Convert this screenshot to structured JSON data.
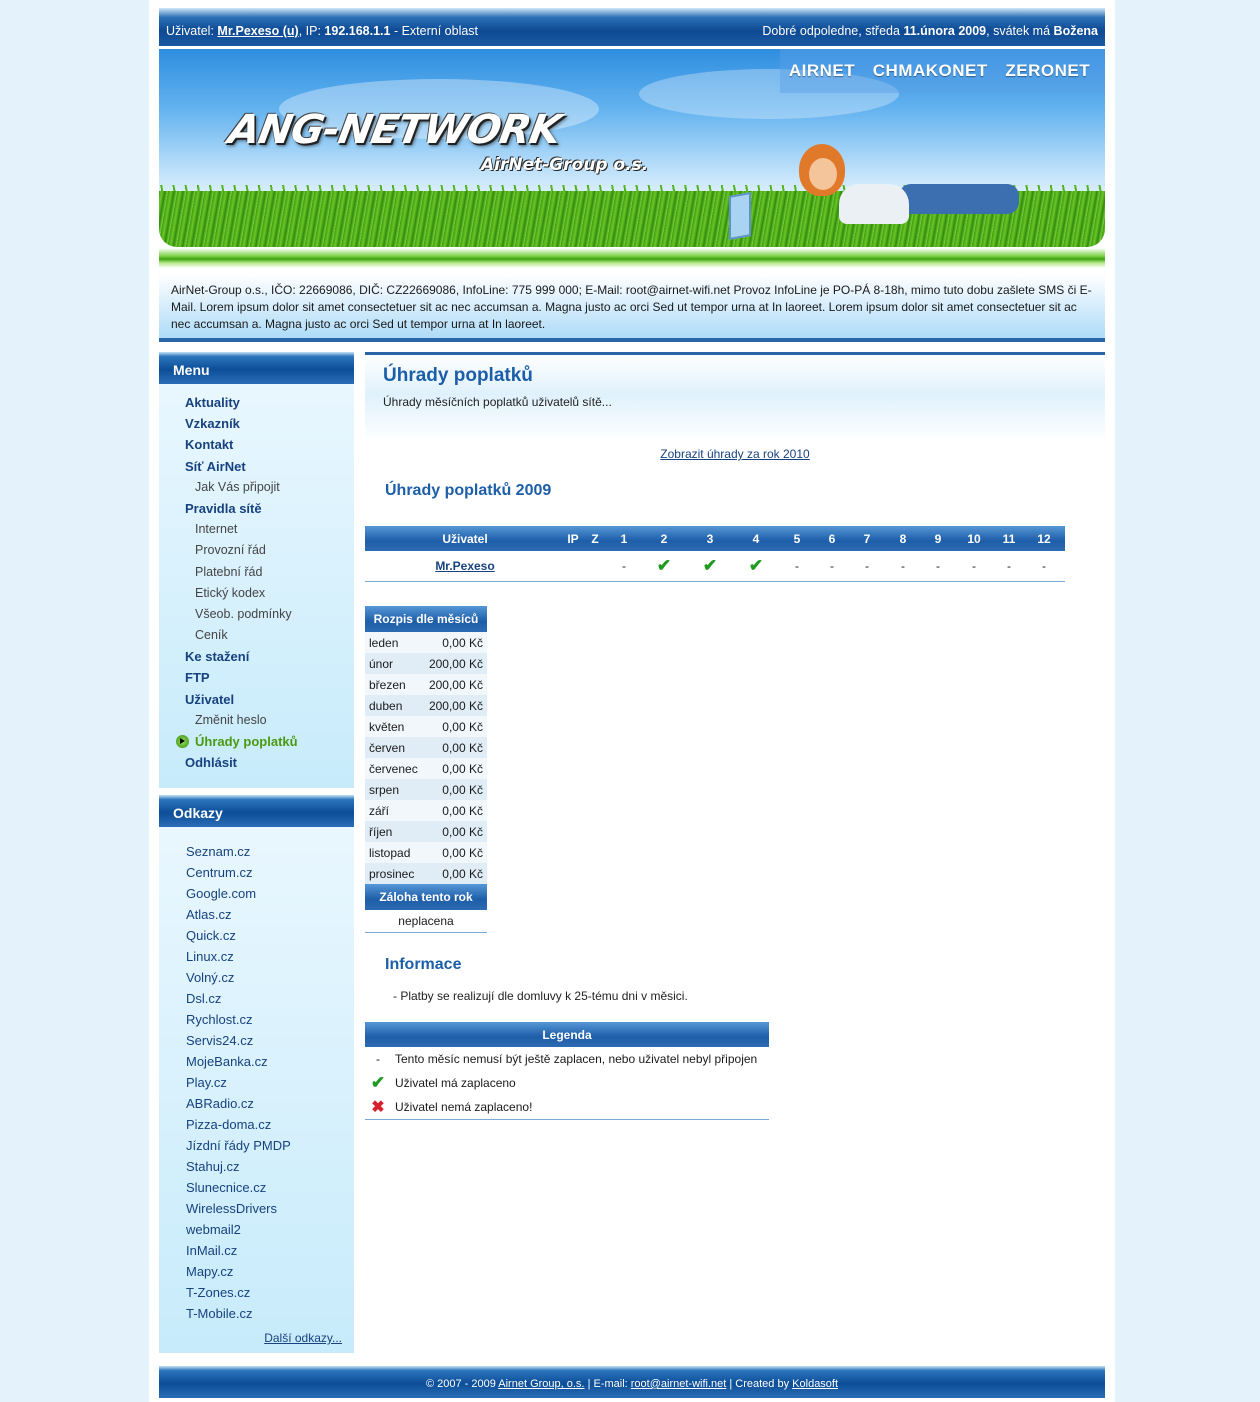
{
  "topbar": {
    "user_label": "Uživatel:",
    "user_name": "Mr.Pexeso (u)",
    "ip_label": ", IP:",
    "ip_value": "192.168.1.1",
    "zone": "- Externí oblast",
    "greeting": "Dobré odpoledne, středa",
    "date": "11.února 2009",
    "nameday_label": ", svátek má",
    "nameday_name": "Božena"
  },
  "header": {
    "nav": [
      "AIRNET",
      "CHMAKONET",
      "ZERONET"
    ],
    "logo_text": "ANG-NETWORK",
    "logo_sub": "AirNet-Group o.s."
  },
  "info_text": "AirNet-Group o.s., IČO: 22669086, DIČ: CZ22669086, InfoLine: 775 999 000; E-Mail: root@airnet-wifi.net Provoz InfoLine je PO-PÁ 8-18h, mimo tuto dobu zašlete SMS či E-Mail. Lorem ipsum dolor sit amet consectetuer sit ac nec accumsan a. Magna justo ac orci Sed ut tempor urna at In laoreet. Lorem ipsum dolor sit amet consectetuer sit ac nec accumsan a. Magna justo ac orci Sed ut tempor urna at In laoreet.",
  "menu": {
    "title": "Menu",
    "items": [
      {
        "label": "Aktuality",
        "level": 1
      },
      {
        "label": "Vzkazník",
        "level": 1
      },
      {
        "label": "Kontakt",
        "level": 1
      },
      {
        "label": "Síť AirNet",
        "level": 1
      },
      {
        "label": "Jak Vás připojit",
        "level": 2
      },
      {
        "label": "Pravidla sítě",
        "level": 1
      },
      {
        "label": "Internet",
        "level": 2
      },
      {
        "label": "Provozní řád",
        "level": 2
      },
      {
        "label": "Platební řád",
        "level": 2
      },
      {
        "label": "Etický kodex",
        "level": 2
      },
      {
        "label": "Všeob. podmínky",
        "level": 2
      },
      {
        "label": "Ceník",
        "level": 2
      },
      {
        "label": "Ke stažení",
        "level": 1
      },
      {
        "label": "FTP",
        "level": 1
      },
      {
        "label": "Uživatel",
        "level": 1
      },
      {
        "label": "Změnit heslo",
        "level": 2
      },
      {
        "label": "Úhrady poplatků",
        "level": 1,
        "active": true
      },
      {
        "label": "Odhlásit",
        "level": 1
      }
    ]
  },
  "links": {
    "title": "Odkazy",
    "items": [
      "Seznam.cz",
      "Centrum.cz",
      "Google.com",
      "Atlas.cz",
      "Quick.cz",
      "Linux.cz",
      "Volný.cz",
      "Dsl.cz",
      "Rychlost.cz",
      "Servis24.cz",
      "MojeBanka.cz",
      "Play.cz",
      "ABRadio.cz",
      "Pizza-doma.cz",
      "Jízdní řády PMDP",
      "Stahuj.cz",
      "Slunecnice.cz",
      "WirelessDrivers",
      "webmail2",
      "InMail.cz",
      "Mapy.cz",
      "T-Zones.cz",
      "T-Mobile.cz"
    ],
    "more": "Další odkazy..."
  },
  "main": {
    "title": "Úhrady poplatků",
    "subtitle": "Úhrady měsíčních poplatků uživatelů sítě...",
    "year_link": "Zobrazit úhrady za rok 2010",
    "section_title": "Úhrady poplatků 2009",
    "pay_table": {
      "headers": [
        "Uživatel",
        "IP",
        "Z",
        "1",
        "2",
        "3",
        "4",
        "5",
        "6",
        "7",
        "8",
        "9",
        "10",
        "11",
        "12"
      ],
      "row": {
        "user": "Mr.Pexeso",
        "ip": "",
        "z": "",
        "months": [
          "-",
          "check",
          "check",
          "check",
          "-",
          "-",
          "-",
          "-",
          "-",
          "-",
          "-",
          "-"
        ]
      }
    },
    "month_breakdown": {
      "title": "Rozpis dle měsíců",
      "rows": [
        {
          "month": "leden",
          "amount": "0,00 Kč"
        },
        {
          "month": "únor",
          "amount": "200,00 Kč"
        },
        {
          "month": "březen",
          "amount": "200,00 Kč"
        },
        {
          "month": "duben",
          "amount": "200,00 Kč"
        },
        {
          "month": "květen",
          "amount": "0,00 Kč"
        },
        {
          "month": "červen",
          "amount": "0,00 Kč"
        },
        {
          "month": "červenec",
          "amount": "0,00 Kč"
        },
        {
          "month": "srpen",
          "amount": "0,00 Kč"
        },
        {
          "month": "září",
          "amount": "0,00 Kč"
        },
        {
          "month": "říjen",
          "amount": "0,00 Kč"
        },
        {
          "month": "listopad",
          "amount": "0,00 Kč"
        },
        {
          "month": "prosinec",
          "amount": "0,00 Kč"
        }
      ],
      "deposit_title": "Záloha tento rok",
      "deposit_value": "neplacena"
    },
    "info_title": "Informace",
    "info_text": "- Platby se realizují dle domluvy k 25-tému dni v měsici.",
    "legend": {
      "title": "Legenda",
      "rows": [
        {
          "symbol": "-",
          "icon": "dash",
          "text": "Tento měsíc nemusí být ještě zaplacen, nebo uživatel nebyl připojen"
        },
        {
          "symbol": "✔",
          "icon": "check-icon",
          "text": "Uživatel má zaplaceno"
        },
        {
          "symbol": "✖",
          "icon": "cross-icon",
          "text": "Uživatel nemá zaplaceno!"
        }
      ]
    }
  },
  "footer": {
    "copyright": "© 2007 - 2009",
    "company_link": "Airnet Group, o.s.",
    "email_label": "| E-mail:",
    "email_link": "root@airnet-wifi.net",
    "created_label": "| Created by",
    "created_link": "Koldasoft"
  },
  "colors": {
    "accent_blue": "#1d5ea9",
    "link_navy": "#17427f",
    "active_green": "#4a9a10",
    "check_green": "#1f9a20",
    "cross_red": "#d6202e"
  }
}
